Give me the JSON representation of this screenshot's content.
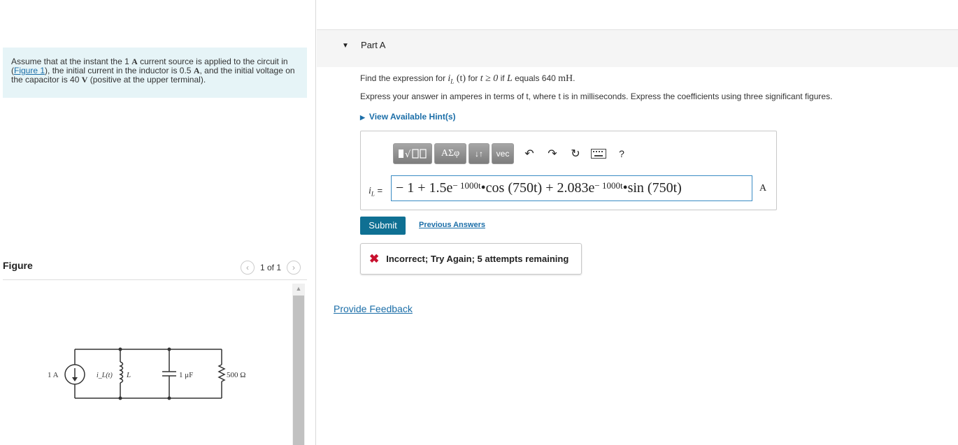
{
  "problem": {
    "text_before_link": "Assume that at the instant the 1 ",
    "source_value": "A",
    "text_mid1": " current source is applied to the circuit in (",
    "figure_link": "Figure 1",
    "text_mid2": "), the initial current in the inductor is 0.5 ",
    "inductor_current_unit": "A",
    "text_mid3": ", and the initial voltage on the capacitor is 40 ",
    "capacitor_voltage_unit": "V",
    "text_end": " (positive at the upper terminal)."
  },
  "figure": {
    "label": "Figure",
    "counter": "1 of 1",
    "prev_icon": "chevron-left-icon",
    "next_icon": "chevron-right-icon",
    "circuit": {
      "source_label": "1 A",
      "inductor_current_label": "i_L(t)",
      "inductor_label": "L",
      "capacitor_label": "1 μF",
      "resistor_label": "500 Ω"
    }
  },
  "part": {
    "toggle_icon": "caret-down-icon",
    "title": "Part A",
    "question_prefix": "Find the expression for ",
    "question_var": "i",
    "question_sub": "L",
    "question_arg": " (t)",
    "question_mid": " for ",
    "question_cond": "t ≥ 0",
    "question_if": " if ",
    "question_L": "L",
    "question_equals": " equals 640 ",
    "question_unit": "mH",
    "question_end": ".",
    "instructions": "Express your answer in amperes in terms of t, where t is in milliseconds. Express the coefficients using three significant figures.",
    "hint": "View Available Hint(s)"
  },
  "toolbar": {
    "templates_icon": "templates-icon",
    "greek_label": "ΑΣφ",
    "arrows_label": "↓↑",
    "vec_label": "vec",
    "undo_icon": "undo-icon",
    "redo_icon": "redo-icon",
    "reset_icon": "reset-icon",
    "keyboard_icon": "keyboard-icon",
    "help_label": "?"
  },
  "answer": {
    "lhs": "i",
    "lhs_sub": "L",
    "lhs_eq": " =",
    "expr_part1": "− 1 + 1.5e",
    "exp1": "− 1000t",
    "dot1": " • ",
    "cos_part": "cos (750t) + 2.083e",
    "exp2": "− 1000t",
    "dot2": " • ",
    "sin_part": "sin (750t)",
    "unit": "A"
  },
  "actions": {
    "submit": "Submit",
    "previous_answers": "Previous Answers"
  },
  "feedback": {
    "icon": "x-icon",
    "status_color": "#c8102e",
    "message": "Incorrect; Try Again; 5 attempts remaining"
  },
  "footer": {
    "provide_feedback": "Provide Feedback"
  }
}
